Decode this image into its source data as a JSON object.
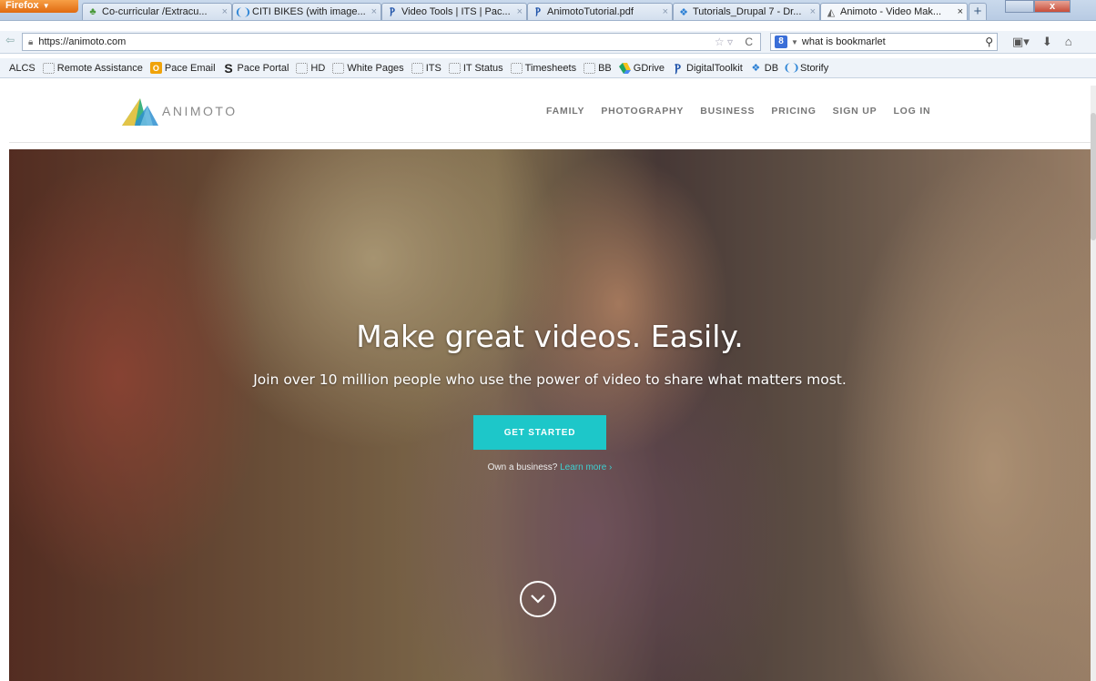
{
  "browser": {
    "app_menu": "Firefox",
    "tabs": [
      {
        "label": "Co-curricular /Extracu...",
        "icon": "plant-icon",
        "active": false
      },
      {
        "label": "CITI BIKES (with image...",
        "icon": "storify-icon",
        "active": false
      },
      {
        "label": "Video Tools | ITS | Pac...",
        "icon": "pace-icon",
        "active": false
      },
      {
        "label": "AnimotoTutorial.pdf",
        "icon": "pace-icon",
        "active": false
      },
      {
        "label": "Tutorials_Drupal 7 - Dr...",
        "icon": "dropbox-icon",
        "active": false
      },
      {
        "label": "Animoto - Video Mak...",
        "icon": "animoto-icon",
        "active": true
      }
    ],
    "url": "https://animoto.com",
    "search_value": "what is bookmarlet"
  },
  "bookmarks": [
    {
      "label": "ALCS",
      "icon": "none"
    },
    {
      "label": "Remote Assistance",
      "icon": "folder-icon"
    },
    {
      "label": "Pace Email",
      "icon": "outlook-icon"
    },
    {
      "label": "Pace Portal",
      "icon": "pace-s-icon"
    },
    {
      "label": "HD",
      "icon": "folder-icon"
    },
    {
      "label": "White Pages",
      "icon": "folder-icon"
    },
    {
      "label": "ITS",
      "icon": "folder-icon"
    },
    {
      "label": "IT Status",
      "icon": "folder-icon"
    },
    {
      "label": "Timesheets",
      "icon": "folder-icon"
    },
    {
      "label": "BB",
      "icon": "folder-icon"
    },
    {
      "label": "GDrive",
      "icon": "gdrive-icon"
    },
    {
      "label": "DigitalToolkit",
      "icon": "pace-icon"
    },
    {
      "label": "DB",
      "icon": "dropbox-icon"
    },
    {
      "label": "Storify",
      "icon": "storify-icon"
    }
  ],
  "site": {
    "logo_text": "ANIMOTO",
    "nav": [
      "FAMILY",
      "PHOTOGRAPHY",
      "BUSINESS",
      "PRICING",
      "SIGN UP",
      "LOG IN"
    ],
    "hero_title": "Make great videos. Easily.",
    "hero_subtitle": "Join over 10 million people who use the power of video to share what matters most.",
    "cta_label": "GET STARTED",
    "business_prompt": "Own a business?",
    "business_link": "Learn more ›"
  },
  "colors": {
    "accent": "#1dc7c9",
    "nav_text": "#777777"
  }
}
